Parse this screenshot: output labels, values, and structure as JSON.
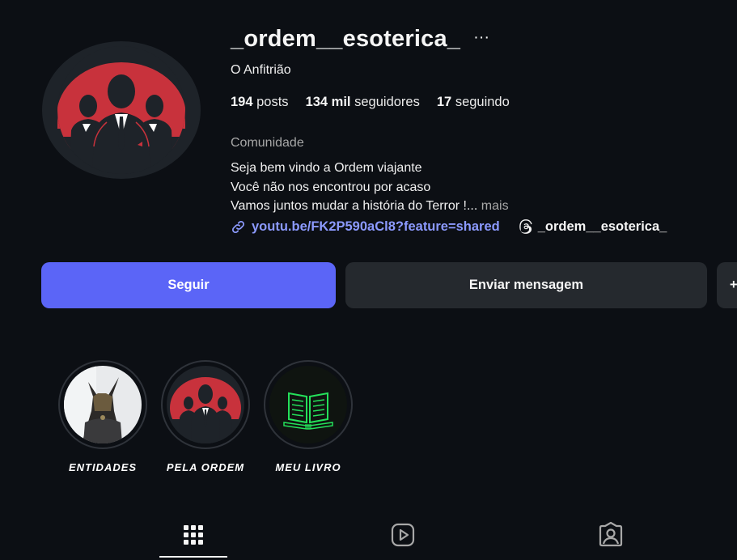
{
  "profile": {
    "username": "_ordem__esoterica_",
    "more_label": "···",
    "full_name": "O Anfitrião",
    "category": "Comunidade"
  },
  "stats": {
    "posts_count": "194",
    "posts_label": "posts",
    "followers_count": "134 mil",
    "followers_label": "seguidores",
    "following_count": "17",
    "following_label": "seguindo"
  },
  "bio": {
    "line1": "Seja bem vindo a Ordem viajante",
    "line2": "Você não nos encontrou por acaso",
    "line3": "Vamos juntos mudar a história do Terror !...",
    "more_label": "mais"
  },
  "links": {
    "url_text": "youtu.be/FK2P590aCl8?feature=shared",
    "threads_handle": "_ordem__esoterica_"
  },
  "actions": {
    "follow_label": "Seguir",
    "message_label": "Enviar mensagem",
    "extra_label": "+"
  },
  "highlights": [
    {
      "label": "ENTIDADES"
    },
    {
      "label": "PELA ORDEM"
    },
    {
      "label": "MEU LIVRO"
    }
  ],
  "tabs": [
    {
      "icon": "grid-icon",
      "active": true
    },
    {
      "icon": "reels-icon",
      "active": false
    },
    {
      "icon": "tagged-icon",
      "active": false
    }
  ],
  "colors": {
    "background": "#0c0f14",
    "follow_button": "#5b65f7",
    "secondary_button": "#25292e",
    "link": "#8c9aff",
    "logo_red": "#c8323c"
  }
}
